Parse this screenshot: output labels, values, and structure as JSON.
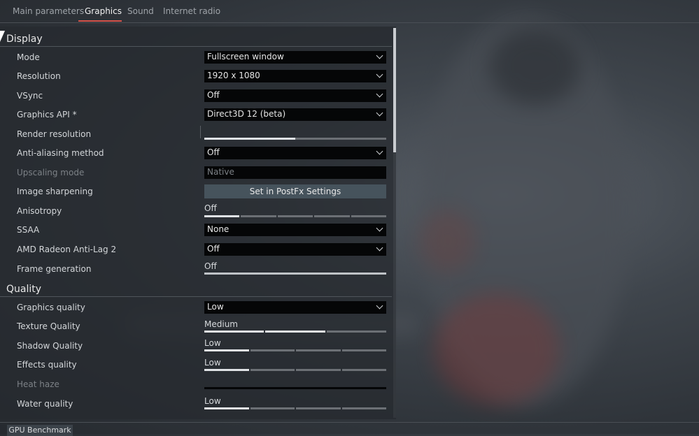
{
  "tabs": [
    {
      "label": "Main parameters"
    },
    {
      "label": "Graphics"
    },
    {
      "label": "Sound"
    },
    {
      "label": "Internet radio"
    }
  ],
  "sections": {
    "display": "Display",
    "quality": "Quality"
  },
  "rows": {
    "mode": {
      "label": "Mode",
      "value": "Fullscreen window"
    },
    "resolution": {
      "label": "Resolution",
      "value": "1920 x 1080"
    },
    "vsync": {
      "label": "VSync",
      "value": "Off"
    },
    "graphics_api": {
      "label": "Graphics API *",
      "value": "Direct3D 12 (beta)"
    },
    "render_resolution": {
      "label": "Render resolution",
      "level": 0.5
    },
    "anti_aliasing": {
      "label": "Anti-aliasing method",
      "value": "Off"
    },
    "upscaling": {
      "label": "Upscaling mode",
      "value": "Native"
    },
    "sharpening": {
      "label": "Image sharpening",
      "button": "Set in PostFx Settings"
    },
    "anisotropy": {
      "label": "Anisotropy",
      "value": "Off",
      "level": 1,
      "steps": 5
    },
    "ssaa": {
      "label": "SSAA",
      "value": "None"
    },
    "anti_lag": {
      "label": "AMD Radeon Anti-Lag 2",
      "value": "Off"
    },
    "frame_gen": {
      "label": "Frame generation",
      "value": "Off"
    },
    "graphics_quality": {
      "label": "Graphics quality",
      "value": "Low"
    },
    "texture_quality": {
      "label": "Texture Quality",
      "value": "Medium",
      "level": 2,
      "steps": 3
    },
    "shadow_quality": {
      "label": "Shadow Quality",
      "value": "Low",
      "level": 1,
      "steps": 4
    },
    "effects_quality": {
      "label": "Effects quality",
      "value": "Low",
      "level": 1,
      "steps": 4
    },
    "heat_haze": {
      "label": "Heat haze"
    },
    "water_quality": {
      "label": "Water quality",
      "value": "Low",
      "level": 1,
      "steps": 4
    }
  },
  "footer": {
    "benchmark": "GPU Benchmark"
  },
  "colors": {
    "accent": "#d4524a",
    "field": "#050607",
    "button": "#46535c"
  }
}
